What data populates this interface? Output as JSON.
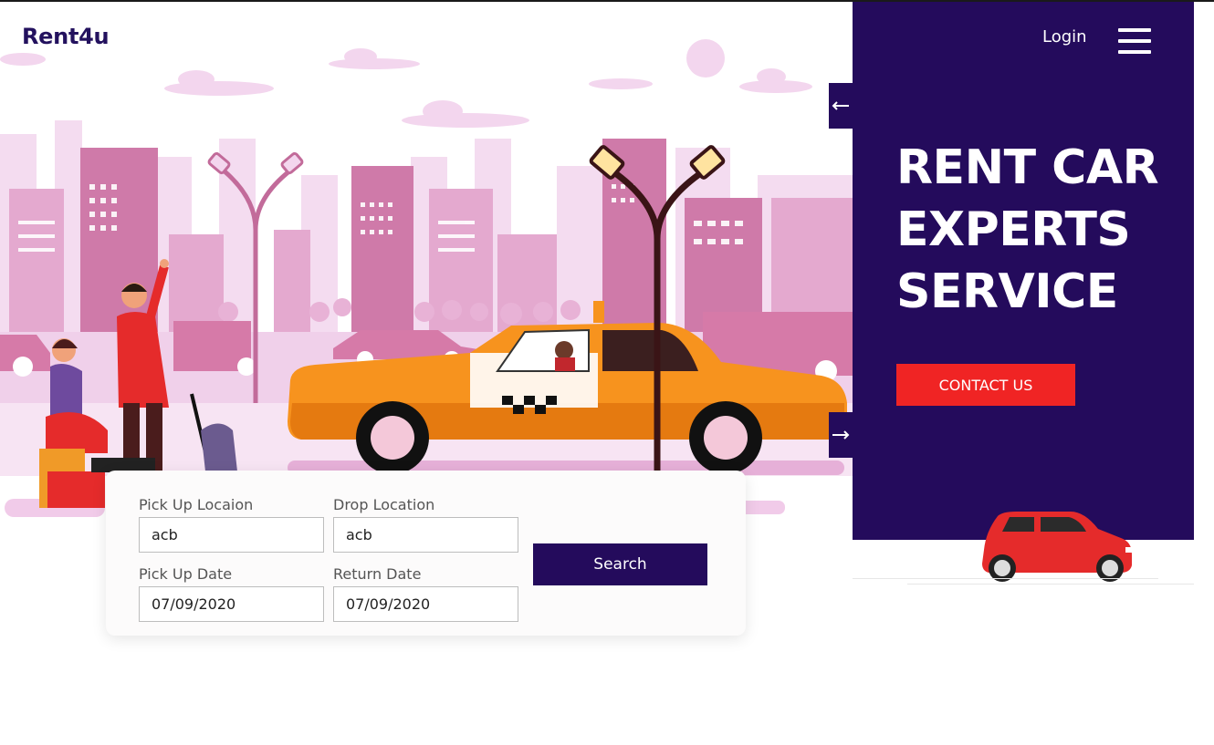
{
  "header": {
    "logo": "Rent4u",
    "login_label": "Login",
    "menu_icon": "hamburger-menu-icon"
  },
  "hero": {
    "headline_lines": [
      "RENT CAR",
      "EXPERTS",
      "SERVICE"
    ],
    "contact_label": "CONTACT US",
    "prev_icon": "arrow-left-icon",
    "next_icon": "arrow-right-icon"
  },
  "search": {
    "pickup_location": {
      "label": "Pick Up Locaion",
      "value": "acb"
    },
    "drop_location": {
      "label": "Drop Location",
      "value": "acb"
    },
    "pickup_date": {
      "label": "Pick Up Date",
      "value": "07/09/2020"
    },
    "return_date": {
      "label": "Return Date",
      "value": "07/09/2020"
    },
    "search_label": "Search"
  },
  "colors": {
    "brand_dark": "#240b5c",
    "accent_red": "#f02424",
    "taxi_orange": "#f7931e"
  }
}
